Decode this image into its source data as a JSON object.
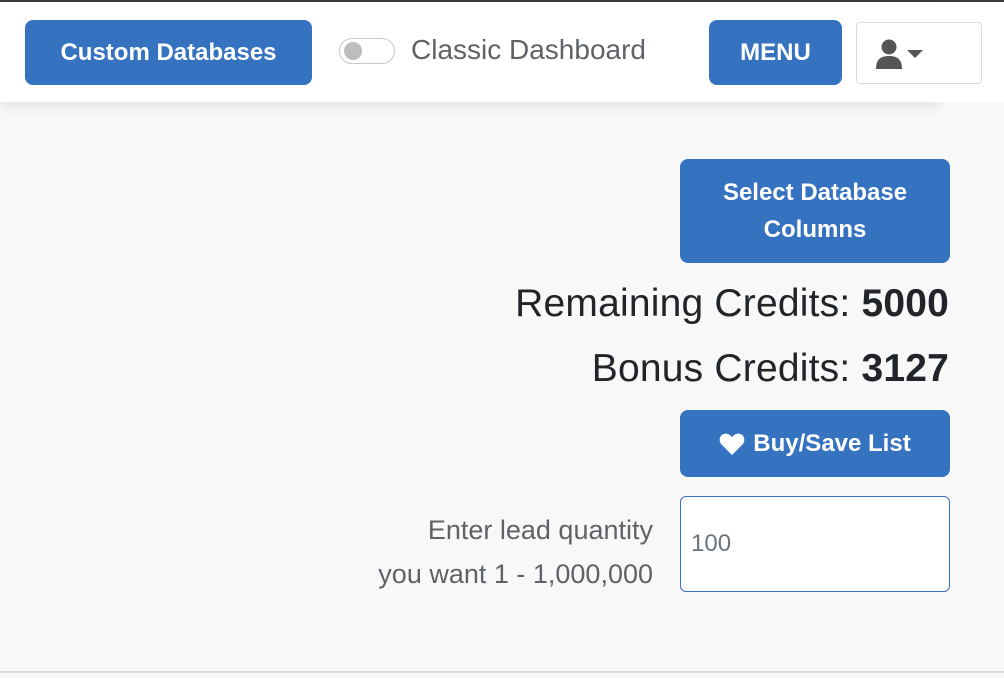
{
  "navbar": {
    "custom_databases_label": "Custom Databases",
    "classic_dashboard_label": "Classic Dashboard",
    "classic_dashboard_enabled": false,
    "menu_label": "MENU"
  },
  "main": {
    "select_columns_label": "Select Database Columns",
    "remaining_credits_label": "Remaining Credits:",
    "remaining_credits_value": "5000",
    "bonus_credits_label": "Bonus Credits:",
    "bonus_credits_value": "3127",
    "buy_save_label": "Buy/Save List",
    "quantity_label_line1": "Enter lead quantity",
    "quantity_label_line2": "you want 1 - 1,000,000",
    "quantity_placeholder": "100"
  },
  "colors": {
    "primary": "#3572c0",
    "background": "#f8f8f8"
  },
  "icons": {
    "user": "user-icon",
    "caret": "caret-down-icon",
    "heart": "heart-icon"
  }
}
